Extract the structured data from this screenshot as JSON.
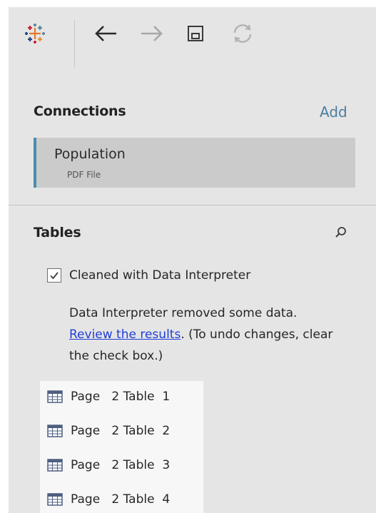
{
  "toolbar": {
    "logo_icon": "tableau-logo-icon",
    "back_icon": "arrow-left-icon",
    "forward_icon": "arrow-right-icon",
    "save_icon": "save-icon",
    "refresh_icon": "refresh-icon"
  },
  "connections": {
    "title": "Connections",
    "add_label": "Add",
    "items": [
      {
        "name": "Population",
        "type": "PDF File"
      }
    ]
  },
  "tables": {
    "title": "Tables",
    "search_icon": "search-icon",
    "interpreter": {
      "checked": true,
      "label": "Cleaned with Data Interpreter",
      "note_before": "Data Interpreter removed some data. ",
      "note_link": "Review the results",
      "note_after": ". (To undo changes, clear the check box.)"
    },
    "items": [
      {
        "label": "Page   2 Table  1"
      },
      {
        "label": "Page   2 Table  2"
      },
      {
        "label": "Page   2 Table  3"
      },
      {
        "label": "Page   2 Table  4"
      }
    ]
  },
  "colors": {
    "panel_bg": "#e5e5e5",
    "accent_blue": "#4a8db0",
    "link_blue": "#1f3ed8",
    "add_link": "#4c7da1"
  }
}
